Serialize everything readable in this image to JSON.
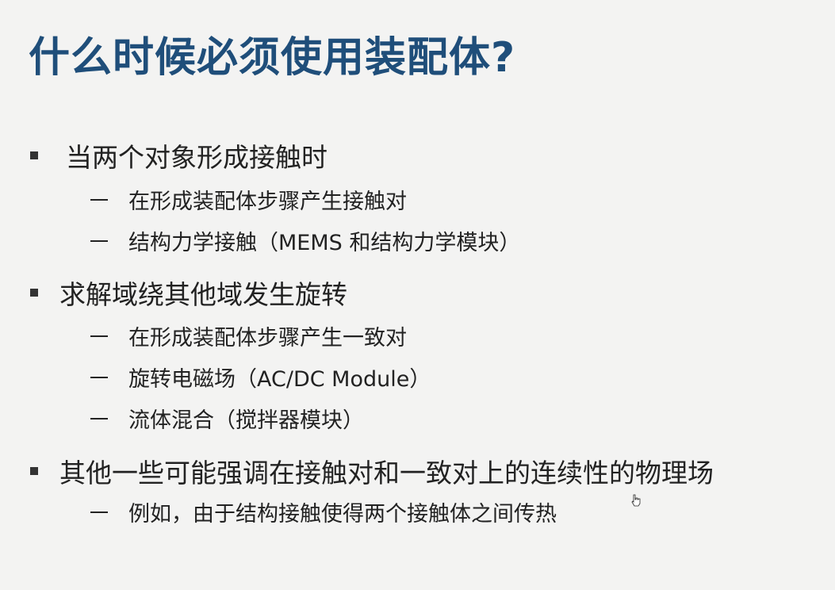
{
  "title": "什么时候必须使用装配体?",
  "bullets": [
    {
      "text": "当两个对象形成接触时",
      "subs": [
        "在形成装配体步骤产生接触对",
        "结构力学接触（MEMS 和结构力学模块）"
      ]
    },
    {
      "text": "求解域绕其他域发生旋转",
      "subs": [
        "在形成装配体步骤产生一致对",
        "旋转电磁场（AC/DC Module）",
        "流体混合（搅拌器模块）"
      ]
    },
    {
      "text": "其他一些可能强调在接触对和一致对上的连续性的物理场",
      "subs": [
        "例如，由于结构接触使得两个接触体之间传热"
      ]
    }
  ]
}
